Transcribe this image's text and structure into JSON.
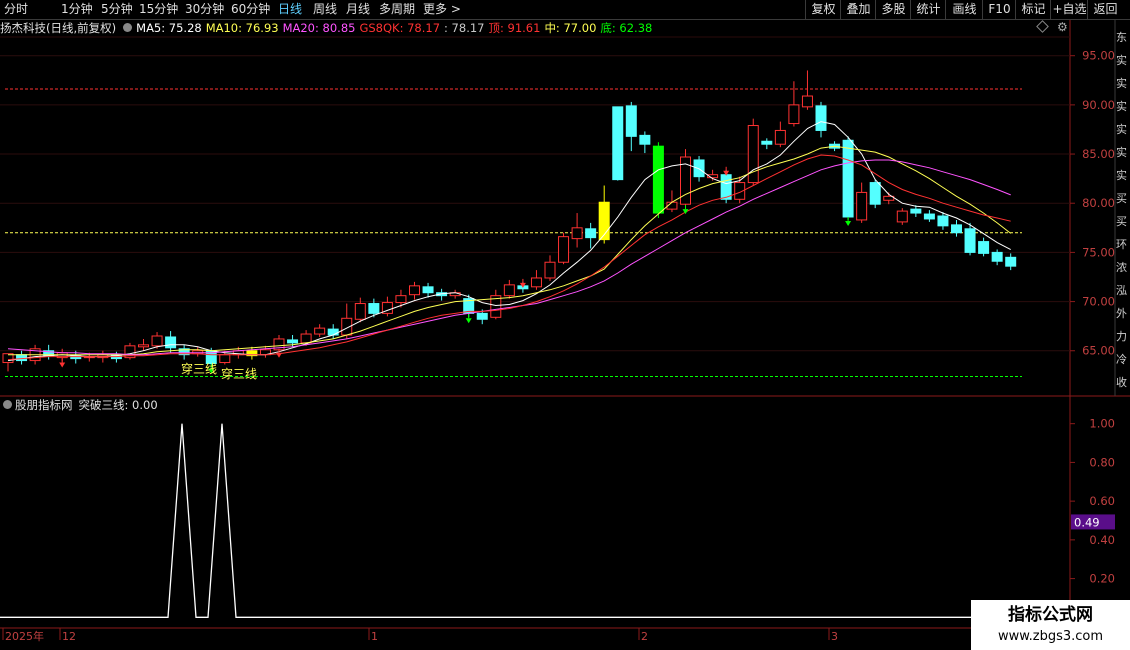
{
  "toolbar": {
    "left_items": [
      "分时",
      "1分钟",
      "5分钟",
      "15分钟",
      "30分钟",
      "60分钟",
      "日线",
      "周线",
      "月线",
      "多周期",
      "更多 >"
    ],
    "active": "日线",
    "right_items": [
      "复权",
      "叠加",
      "多股",
      "统计",
      "画线",
      "F10",
      "标记",
      "+自选",
      "返回"
    ]
  },
  "header": {
    "stock": "扬杰科技(日线,前复权)",
    "ma5": "MA5: 75.28",
    "ma10": "MA10: 76.93",
    "ma20": "MA20: 80.85",
    "gs8qk": "GS8QK: 78.17",
    "gs8qk2": ": 78.17",
    "top": "顶: 91.61",
    "mid": "中: 77.00",
    "bottom": "底: 62.38"
  },
  "indicator": {
    "title": "股朋指标网",
    "label": "突破三线: 0.00"
  },
  "colors": {
    "up": "#ff3232",
    "down": "#54ffff",
    "ma5": "#ffffff",
    "ma10": "#ffff54",
    "ma20": "#ff54ff",
    "gs8qk": "#ff3232",
    "top_line": "#ff3232",
    "mid_line": "#ffff54",
    "bottom_line": "#00ff00"
  },
  "right_strip_chars": [
    "东",
    "实",
    "实",
    "实",
    "实",
    "实",
    "实",
    "买",
    "买",
    "环",
    "浓",
    "泓",
    "外",
    "力",
    "冷",
    "收"
  ],
  "watermark": {
    "line1": "指标公式网",
    "line2": "www.zbgs3.com"
  },
  "chart_data": [
    {
      "type": "candlestick",
      "title": "扬杰科技(日线,前复权)",
      "y_ticks": [
        "95.00",
        "90.00",
        "85.00",
        "80.00",
        "75.00",
        "70.00",
        "65.00"
      ],
      "ylim": [
        60.5,
        96.8
      ],
      "x_labels": [
        "2025年",
        "12",
        "1",
        "2",
        "3"
      ],
      "hlines": {
        "top": 91.61,
        "mid": 77.0,
        "bottom": 62.38
      },
      "annotations": [
        "穿三线",
        "穿三线"
      ],
      "candles": [
        [
          63.8,
          64.7,
          63.1,
          62.9
        ],
        [
          64.6,
          64.0,
          65.0,
          63.6
        ],
        [
          64.0,
          65.2,
          63.6,
          65.6
        ],
        [
          65.0,
          64.5,
          65.6,
          64.1
        ],
        [
          64.3,
          64.8,
          63.9,
          65.2
        ],
        [
          64.5,
          64.2,
          65.0,
          63.7
        ],
        [
          64.3,
          64.4,
          63.9,
          64.8
        ],
        [
          64.3,
          64.6,
          63.8,
          65.0
        ],
        [
          64.6,
          64.2,
          64.9,
          63.8
        ],
        [
          64.3,
          65.5,
          64.1,
          65.8
        ],
        [
          65.4,
          65.6,
          65.0,
          66.2
        ],
        [
          65.5,
          66.5,
          65.2,
          66.9
        ],
        [
          66.4,
          65.3,
          67.0,
          64.8
        ],
        [
          65.2,
          64.6,
          65.6,
          64.1
        ],
        [
          64.7,
          65.0,
          64.4,
          65.4
        ],
        [
          65.0,
          63.7,
          65.3,
          63.3
        ],
        [
          63.8,
          64.6,
          63.6,
          65.0
        ],
        [
          64.6,
          65.0,
          64.2,
          65.4
        ],
        [
          65.0,
          64.5,
          65.4,
          64.1
        ],
        [
          64.6,
          65.1,
          64.3,
          65.5
        ],
        [
          65.1,
          66.2,
          64.9,
          66.6
        ],
        [
          66.1,
          65.8,
          66.6,
          65.4
        ],
        [
          65.8,
          66.7,
          65.5,
          67.1
        ],
        [
          66.7,
          67.3,
          66.4,
          67.7
        ],
        [
          67.2,
          66.6,
          67.7,
          66.2
        ],
        [
          66.6,
          68.3,
          66.2,
          69.8
        ],
        [
          68.2,
          69.8,
          67.9,
          70.4
        ],
        [
          69.8,
          68.8,
          70.3,
          68.4
        ],
        [
          68.8,
          69.9,
          68.5,
          70.5
        ],
        [
          69.9,
          70.6,
          69.4,
          71.2
        ],
        [
          70.7,
          71.6,
          70.2,
          72.0
        ],
        [
          71.5,
          70.9,
          71.9,
          70.4
        ],
        [
          70.9,
          70.6,
          71.3,
          70.1
        ],
        [
          70.6,
          70.9,
          70.3,
          71.2
        ],
        [
          70.3,
          68.8,
          70.7,
          68.4
        ],
        [
          68.8,
          68.2,
          69.2,
          67.7
        ],
        [
          68.4,
          70.6,
          68.2,
          71.2
        ],
        [
          70.6,
          71.7,
          70.3,
          72.2
        ],
        [
          71.6,
          71.3,
          72.0,
          70.9
        ],
        [
          71.5,
          72.4,
          71.2,
          73.2
        ],
        [
          72.4,
          74.0,
          72.1,
          74.7
        ],
        [
          74.0,
          76.6,
          73.8,
          77.0
        ],
        [
          76.4,
          77.5,
          75.5,
          79.0
        ],
        [
          77.4,
          76.5,
          78.0,
          75.4
        ],
        [
          76.3,
          80.1,
          75.9,
          81.8
        ],
        [
          89.8,
          82.4,
          89.8,
          82.3
        ],
        [
          89.9,
          86.8,
          90.3,
          85.3
        ],
        [
          86.9,
          86.0,
          87.3,
          85.1
        ],
        [
          85.8,
          79.0,
          86.2,
          78.5
        ],
        [
          79.4,
          80.1,
          79.1,
          81.3
        ],
        [
          79.9,
          84.7,
          79.5,
          85.5
        ],
        [
          84.4,
          82.7,
          84.8,
          82.2
        ],
        [
          82.6,
          82.9,
          82.3,
          83.4
        ],
        [
          82.9,
          80.4,
          83.4,
          80.0
        ],
        [
          80.4,
          82.1,
          80.0,
          82.7
        ],
        [
          82.1,
          87.9,
          81.8,
          88.6
        ],
        [
          86.3,
          86.0,
          86.6,
          85.5
        ],
        [
          86.0,
          87.4,
          85.7,
          88.3
        ],
        [
          88.1,
          90.0,
          87.8,
          92.4
        ],
        [
          89.8,
          90.9,
          89.5,
          93.5
        ],
        [
          89.9,
          87.4,
          90.3,
          86.7
        ],
        [
          86.0,
          85.6,
          86.3,
          85.3
        ],
        [
          86.4,
          78.6,
          86.8,
          78.3
        ],
        [
          78.3,
          81.1,
          78.0,
          82.1
        ],
        [
          82.1,
          79.9,
          82.4,
          79.5
        ],
        [
          80.3,
          80.7,
          79.9,
          81.1
        ],
        [
          78.1,
          79.2,
          77.8,
          79.5
        ],
        [
          79.4,
          79.0,
          79.8,
          78.6
        ],
        [
          78.9,
          78.4,
          79.3,
          78.1
        ],
        [
          78.7,
          77.7,
          79.1,
          77.3
        ],
        [
          77.8,
          77.0,
          78.3,
          76.6
        ],
        [
          77.4,
          75.0,
          78.0,
          74.7
        ],
        [
          76.1,
          74.9,
          76.5,
          74.6
        ],
        [
          75.0,
          74.1,
          75.3,
          73.7
        ],
        [
          74.5,
          73.6,
          74.9,
          73.2
        ]
      ],
      "special_bars": {
        "yellow": [
          18
        ],
        "green": [
          48
        ],
        "thick_yellow": [
          44
        ],
        "yellow_small": [
          13
        ]
      },
      "series": [
        {
          "name": "MA5",
          "values": [
            64.0,
            64.2,
            64.4,
            64.5,
            64.6,
            64.5,
            64.4,
            64.4,
            64.5,
            64.7,
            65.0,
            65.4,
            65.6,
            65.6,
            65.4,
            65.0,
            64.8,
            64.7,
            64.6,
            64.6,
            64.9,
            65.3,
            65.7,
            66.2,
            66.6,
            67.3,
            68.0,
            68.6,
            69.1,
            69.6,
            70.1,
            70.5,
            70.8,
            70.9,
            70.5,
            69.9,
            69.6,
            69.7,
            70.1,
            70.8,
            71.7,
            72.9,
            74.0,
            75.2,
            76.8,
            78.6,
            80.6,
            82.4,
            83.4,
            83.8,
            84.0,
            83.5,
            82.5,
            82.0,
            82.3,
            83.4,
            84.0,
            84.9,
            86.3,
            87.6,
            88.3,
            88.0,
            86.7,
            85.0,
            82.4,
            80.9,
            80.0,
            79.7,
            79.6,
            79.0,
            78.5,
            77.8,
            76.9,
            76.0,
            75.28
          ]
        },
        {
          "name": "MA10",
          "values": [
            64.6,
            64.6,
            64.6,
            64.6,
            64.6,
            64.6,
            64.6,
            64.6,
            64.6,
            64.6,
            64.7,
            64.9,
            65.0,
            65.1,
            65.1,
            65.0,
            65.1,
            65.2,
            65.3,
            65.4,
            65.5,
            65.6,
            65.8,
            66.0,
            66.2,
            66.6,
            67.0,
            67.5,
            68.0,
            68.5,
            69.0,
            69.4,
            69.7,
            70.0,
            70.1,
            70.2,
            70.3,
            70.4,
            70.6,
            70.9,
            71.2,
            71.6,
            72.1,
            72.6,
            73.3,
            74.8,
            76.3,
            77.7,
            78.9,
            80.1,
            80.9,
            81.5,
            82.0,
            82.3,
            82.6,
            83.2,
            83.7,
            84.1,
            84.5,
            85.0,
            85.6,
            85.8,
            85.6,
            85.4,
            85.2,
            84.7,
            84.0,
            83.3,
            82.5,
            81.6,
            80.7,
            79.9,
            79.0,
            78.0,
            76.93
          ]
        },
        {
          "name": "MA20",
          "values": [
            65.2,
            65.1,
            65.0,
            64.9,
            64.8,
            64.8,
            64.7,
            64.7,
            64.7,
            64.6,
            64.6,
            64.7,
            64.8,
            64.8,
            64.8,
            64.8,
            64.9,
            65.0,
            65.1,
            65.2,
            65.3,
            65.4,
            65.6,
            65.8,
            66.0,
            66.2,
            66.5,
            66.8,
            67.1,
            67.4,
            67.7,
            68.0,
            68.3,
            68.6,
            68.8,
            69.0,
            69.2,
            69.4,
            69.6,
            69.8,
            70.2,
            70.6,
            71.0,
            71.5,
            72.1,
            72.9,
            73.8,
            74.6,
            75.4,
            76.2,
            77.0,
            77.7,
            78.4,
            79.1,
            79.7,
            80.4,
            81.0,
            81.6,
            82.2,
            82.8,
            83.4,
            83.8,
            84.1,
            84.3,
            84.4,
            84.4,
            84.2,
            83.9,
            83.6,
            83.2,
            82.8,
            82.4,
            81.9,
            81.4,
            80.85
          ]
        },
        {
          "name": "GS8QK",
          "values": [
            64.1,
            64.2,
            64.3,
            64.4,
            64.4,
            64.4,
            64.4,
            64.4,
            64.4,
            64.5,
            64.5,
            64.6,
            64.7,
            64.7,
            64.7,
            64.6,
            64.6,
            64.6,
            64.6,
            64.6,
            64.7,
            64.9,
            65.1,
            65.3,
            65.6,
            65.9,
            66.3,
            66.7,
            67.1,
            67.5,
            67.9,
            68.3,
            68.6,
            68.8,
            69.0,
            69.0,
            69.1,
            69.3,
            69.6,
            70.0,
            70.5,
            71.1,
            71.8,
            72.6,
            73.5,
            74.6,
            75.7,
            76.8,
            77.6,
            78.3,
            79.1,
            79.8,
            80.3,
            80.6,
            81.1,
            81.8,
            82.5,
            83.2,
            83.9,
            84.5,
            84.9,
            84.8,
            84.4,
            83.9,
            83.0,
            82.1,
            81.4,
            80.9,
            80.5,
            80.0,
            79.6,
            79.2,
            78.8,
            78.5,
            78.17
          ]
        }
      ]
    },
    {
      "type": "line",
      "title": "突破三线",
      "y_ticks": [
        "1.00",
        "0.80",
        "0.60",
        "0.40",
        "0.20"
      ],
      "ylim": [
        -0.05,
        1.05
      ],
      "current_value": "0.49",
      "x": [
        "0",
        "13",
        "14",
        "15",
        "16",
        "17",
        "18",
        "19"
      ],
      "values": [
        0,
        0,
        1,
        0,
        0,
        1,
        0,
        0
      ]
    }
  ]
}
